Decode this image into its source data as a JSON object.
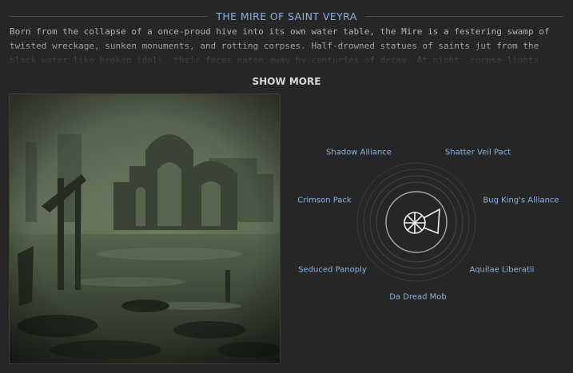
{
  "location": {
    "title": "THE MIRE OF SAINT VEYRA",
    "description": "Born from the collapse of a once-proud hive into its own water table, the Mire is a festering swamp of twisted wreckage, sunken monuments, and rotting corpses. Half-drowned statues of saints jut from the black water like broken idols, their faces eaten away by centuries of decay. At night, corpse-lights drift across the surface,",
    "show_more_label": "SHOW MORE"
  },
  "factions": {
    "emblem_icon": "faction-wheel-icon",
    "items": [
      {
        "label": "Shadow Alliance"
      },
      {
        "label": "Shatter Veil Pact"
      },
      {
        "label": "Crimson Pack"
      },
      {
        "label": "Bug King's Alliance"
      },
      {
        "label": "Seduced Panoply"
      },
      {
        "label": "Aquilae Liberatii"
      },
      {
        "label": "Da Dread Mob"
      }
    ]
  },
  "colors": {
    "accent": "#8ab4e6",
    "background": "#262626"
  }
}
